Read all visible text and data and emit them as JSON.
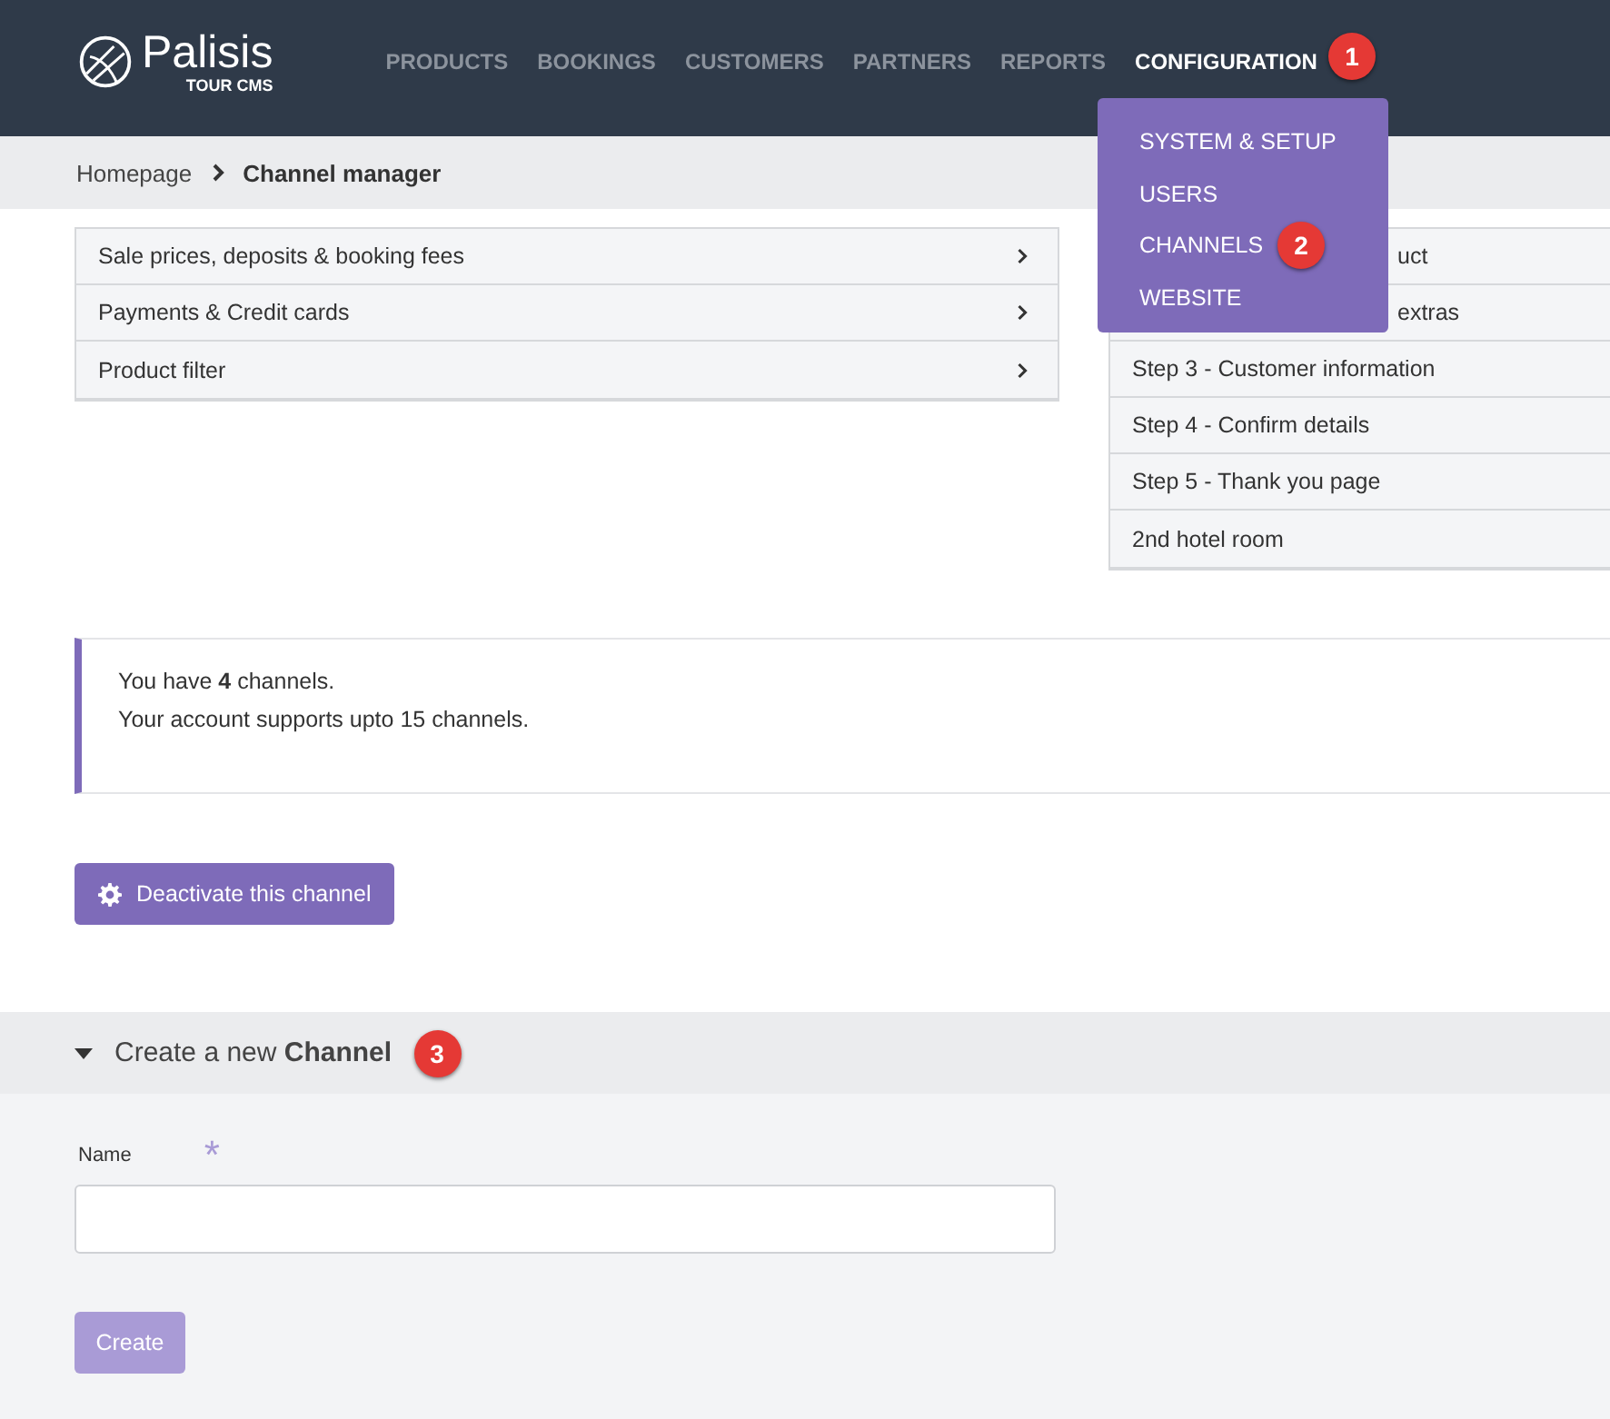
{
  "header": {
    "logo": {
      "name": "Palisis",
      "tagline": "TOUR CMS"
    },
    "nav": [
      {
        "label": "PRODUCTS",
        "selected": false
      },
      {
        "label": "BOOKINGS",
        "selected": false
      },
      {
        "label": "CUSTOMERS",
        "selected": false
      },
      {
        "label": "PARTNERS",
        "selected": false
      },
      {
        "label": "REPORTS",
        "selected": false
      },
      {
        "label": "CONFIGURATION",
        "selected": true,
        "badge": "1"
      }
    ],
    "dropdown": [
      {
        "label": "SYSTEM & SETUP"
      },
      {
        "label": "USERS"
      },
      {
        "label": "CHANNELS",
        "badge": "2"
      },
      {
        "label": "WEBSITE"
      }
    ]
  },
  "breadcrumb": {
    "home": "Homepage",
    "current": "Channel manager"
  },
  "settings_list": [
    "Sale prices, deposits & booking fees",
    "Payments & Credit cards",
    "Product filter"
  ],
  "steps_list": [
    {
      "kind": "partial",
      "label": "uct"
    },
    {
      "kind": "partial",
      "label": "extras"
    },
    {
      "kind": "step",
      "label": "Step 3 - Customer information"
    },
    {
      "kind": "step",
      "label": "Step 4 - Confirm details"
    },
    {
      "kind": "step",
      "label": "Step 5 - Thank you page"
    },
    {
      "kind": "step",
      "label": "2nd hotel room"
    }
  ],
  "info": [
    "You have **4** channels.",
    "Your account supports upto 15 channels."
  ],
  "deactivate_button": "Deactivate this channel",
  "create_section": {
    "title": "Create a new **Channel**",
    "badge": "3",
    "expanded": true,
    "field_label": "Name",
    "required_mark": "*",
    "button": {
      "label": "Create",
      "disabled": true
    }
  }
}
